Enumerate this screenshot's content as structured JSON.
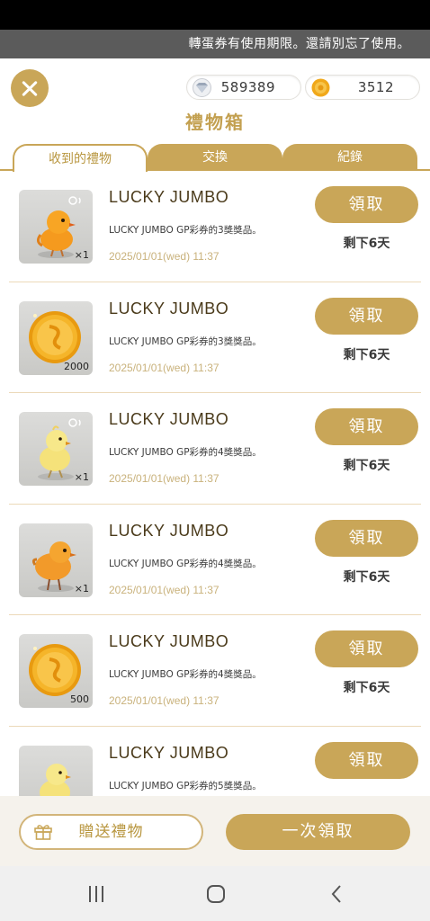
{
  "notice": "轉蛋券有使用期限。還請別忘了使用。",
  "currencies": {
    "gems": "589389",
    "coins": "3512"
  },
  "title": "禮物箱",
  "tabs": [
    "收到的禮物",
    "交換",
    "紀錄"
  ],
  "gifts": [
    {
      "title": "LUCKY JUMBO",
      "desc": "LUCKY JUMBO GP彩券的3獎獎品。",
      "date": "2025/01/01(wed) 11:37",
      "qty": "×1",
      "item": "orange-chick-icon",
      "claim": "領取",
      "remain": "剩下6天"
    },
    {
      "title": "LUCKY JUMBO",
      "desc": "LUCKY JUMBO GP彩券的3獎獎品。",
      "date": "2025/01/01(wed) 11:37",
      "qty": "2000",
      "item": "gold-coin-icon",
      "claim": "領取",
      "remain": "剩下6天"
    },
    {
      "title": "LUCKY JUMBO",
      "desc": "LUCKY JUMBO GP彩券的4獎獎品。",
      "date": "2025/01/01(wed) 11:37",
      "qty": "×1",
      "item": "yellow-chick-icon",
      "claim": "領取",
      "remain": "剩下6天"
    },
    {
      "title": "LUCKY JUMBO",
      "desc": "LUCKY JUMBO GP彩券的4獎獎品。",
      "date": "2025/01/01(wed) 11:37",
      "qty": "×1",
      "item": "orange-bird-icon",
      "claim": "領取",
      "remain": "剩下6天"
    },
    {
      "title": "LUCKY JUMBO",
      "desc": "LUCKY JUMBO GP彩券的4獎獎品。",
      "date": "2025/01/01(wed) 11:37",
      "qty": "500",
      "item": "gold-coin-icon",
      "claim": "領取",
      "remain": "剩下6天"
    },
    {
      "title": "LUCKY JUMBO",
      "desc": "LUCKY JUMBO GP彩券的5獎獎品。",
      "date": "",
      "qty": "",
      "item": "yellow-chick-icon",
      "claim": "領取",
      "remain": ""
    }
  ],
  "footer": {
    "gift_label": "贈送禮物",
    "claim_all_label": "一次領取"
  },
  "colors": {
    "accent": "#c9a658",
    "notice_bg": "#5b5b5b"
  }
}
